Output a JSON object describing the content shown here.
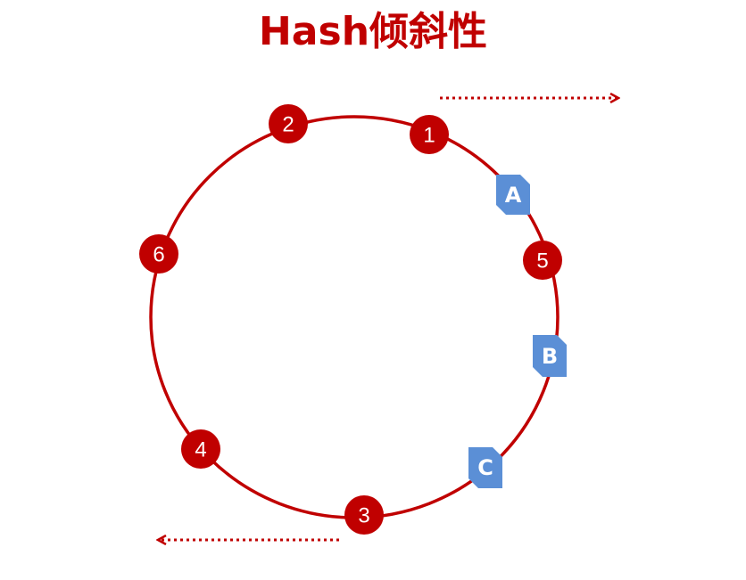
{
  "title": "Hash倾斜性",
  "colors": {
    "accent": "#c00000",
    "node_fill": "#c00000",
    "server_fill": "#5b8fd6",
    "background": "#ffffff"
  },
  "nodes": [
    {
      "id": "1",
      "label": "1"
    },
    {
      "id": "2",
      "label": "2"
    },
    {
      "id": "3",
      "label": "3"
    },
    {
      "id": "4",
      "label": "4"
    },
    {
      "id": "5",
      "label": "5"
    },
    {
      "id": "6",
      "label": "6"
    }
  ],
  "servers": [
    {
      "id": "A",
      "label": "A"
    },
    {
      "id": "B",
      "label": "B"
    },
    {
      "id": "C",
      "label": "C"
    }
  ]
}
